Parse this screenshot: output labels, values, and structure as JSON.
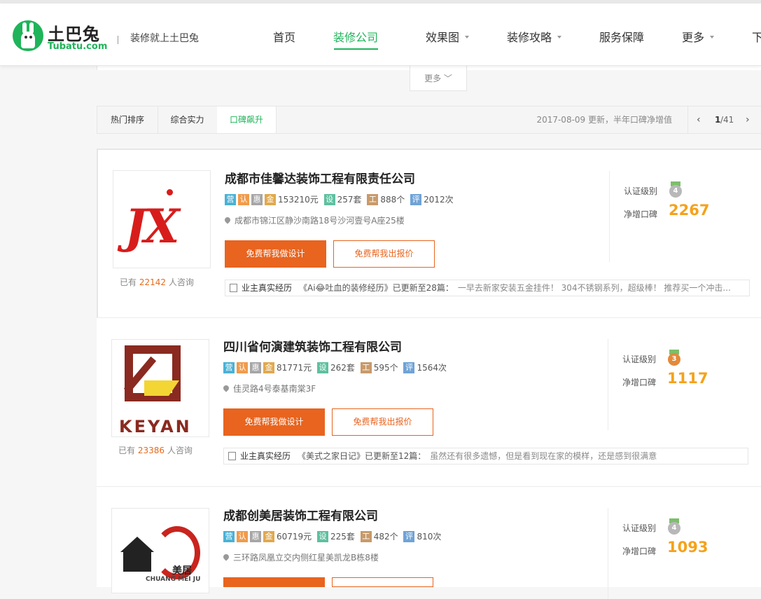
{
  "header": {
    "logo_zh": "土巴兔",
    "logo_en": "Tubatu.com",
    "slogan": "装修就上土巴兔",
    "nav": [
      {
        "label": "首页"
      },
      {
        "label": "装修公司"
      },
      {
        "label": "效果图"
      },
      {
        "label": "装修攻略"
      },
      {
        "label": "服务保障"
      },
      {
        "label": "更多"
      },
      {
        "label": "下"
      }
    ]
  },
  "filter": {
    "more_label": "更多"
  },
  "sortbar": {
    "tabs": [
      {
        "label": "热门排序"
      },
      {
        "label": "综合实力"
      },
      {
        "label": "口碑飙升"
      }
    ],
    "info": "2017-08-09 更新，半年口碑净增值",
    "page_current": "1",
    "page_total": "/41"
  },
  "labels": {
    "consult_prefix": "已有",
    "consult_suffix": "人咨询",
    "design_btn": "免费帮我做设计",
    "quote_btn": "免费帮我出报价",
    "diary_label": "业主真实经历",
    "cert_label": "认证级别",
    "score_label": "净增口碑",
    "badge_ying": "营",
    "badge_ren": "认",
    "badge_hui": "惠",
    "badge_jin": "金",
    "badge_she": "设",
    "badge_gong": "工",
    "badge_ping": "评"
  },
  "companies": [
    {
      "name": "成都市佳馨达装饰工程有限责任公司",
      "money": "153210元",
      "designs": "257套",
      "sites": "888个",
      "reviews": "2012次",
      "address": "成都市锦江区静沙南路18号沙河壹号A座25楼",
      "consult": "22142",
      "diary_title": "《Ai😂吐血的装修经历》已更新至28篇：",
      "diary_text": "一早去新家安装五金挂件！ 304不锈钢系列，超级棒！ 推荐买一个冲击...",
      "cert_level": "4",
      "score": "2267",
      "medal_color": "#b8b8b8",
      "logo_text": "JX"
    },
    {
      "name": "四川省何演建筑装饰工程有限公司",
      "money": "81771元",
      "designs": "262套",
      "sites": "595个",
      "reviews": "1564次",
      "address": "佳灵路4号泰基南棠3F",
      "consult": "23386",
      "diary_title": "《美式之家日记》已更新至12篇：",
      "diary_text": "虽然还有很多遗憾，但是看到现在家的模样，还是感到很满意",
      "cert_level": "3",
      "score": "1117",
      "medal_color": "#e38a3a",
      "logo_text": "KEYAN"
    },
    {
      "name": "成都创美居装饰工程有限公司",
      "money": "60719元",
      "designs": "225套",
      "sites": "482个",
      "reviews": "810次",
      "address": "三环路凤凰立交内侧红星美凯龙B栋8楼",
      "cert_level": "4",
      "score": "1093",
      "medal_color": "#b8b8b8",
      "logo_text": "美居",
      "logo_sub": "CHUANG MEI JU"
    }
  ]
}
